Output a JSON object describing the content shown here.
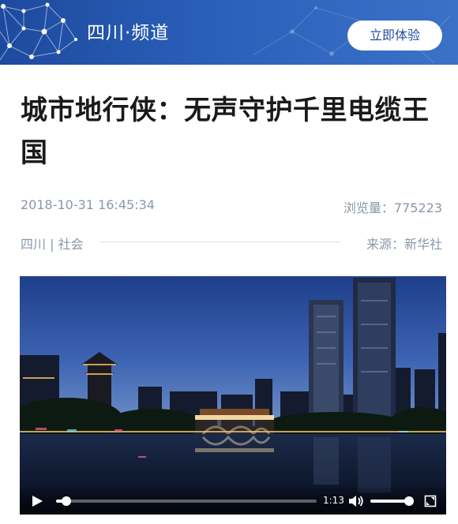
{
  "header": {
    "channel_title": "四川·频道",
    "try_button": "立即体验",
    "bg_color": "#2a5fb8"
  },
  "article": {
    "title": "城市地行侠：无声守护千里电缆王国",
    "datetime": "2018-10-31 16:45:34",
    "views_label": "浏览量：",
    "views_count": "775223",
    "category": "四川 | 社会",
    "source": "来源：新华社"
  },
  "video": {
    "scene": "night-city-skyline-river-bridge",
    "current_time": "1:13",
    "progress_fraction": 0.04,
    "volume_fraction": 0.95,
    "icons": [
      "play-icon",
      "volume-icon",
      "fullscreen-icon"
    ]
  }
}
